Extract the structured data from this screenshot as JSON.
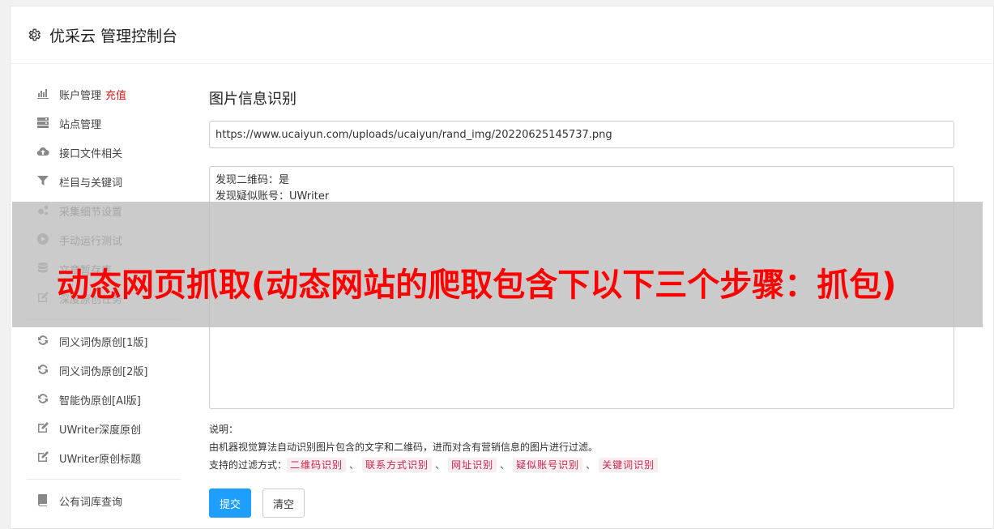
{
  "header": {
    "title": "优采云 管理控制台"
  },
  "sidebar": {
    "group1": [
      {
        "label": "账户管理",
        "extra": "充值",
        "icon": "bar-chart-icon"
      },
      {
        "label": "站点管理",
        "icon": "server-icon"
      },
      {
        "label": "接口文件相关",
        "icon": "cloud-upload-icon"
      },
      {
        "label": "栏目与关键词",
        "icon": "filter-icon"
      },
      {
        "label": "采集细节设置",
        "icon": "gears-icon"
      },
      {
        "label": "手动运行测试",
        "icon": "play-circle-icon"
      },
      {
        "label": "文章暂存库",
        "icon": "database-icon"
      },
      {
        "label": "深度原创任务",
        "icon": "edit-icon"
      }
    ],
    "group2": [
      {
        "label": "同义词伪原创[1版]",
        "icon": "refresh-icon"
      },
      {
        "label": "同义词伪原创[2版]",
        "icon": "refresh-icon"
      },
      {
        "label": "智能伪原创[AI版]",
        "icon": "refresh-icon"
      },
      {
        "label": "UWriter深度原创",
        "icon": "edit-icon"
      },
      {
        "label": "UWriter原创标题",
        "icon": "edit-icon"
      }
    ],
    "group3": [
      {
        "label": "公有词库查询",
        "icon": "book-icon"
      }
    ]
  },
  "main": {
    "title": "图片信息识别",
    "url_value": "https://www.ucaiyun.com/uploads/ucaiyun/rand_img/20220625145737.png",
    "result_text": "发现二维码：是\n发现疑似账号：UWriter",
    "notes": {
      "heading": "说明：",
      "desc": "由机器视觉算法自动识别图片包含的文字和二维码，进而对含有营销信息的图片进行过滤。",
      "methods_label": "支持的过滤方式：",
      "methods": [
        "二维码识别",
        "联系方式识别",
        "网址识别",
        "疑似账号识别",
        "关键词识别"
      ],
      "separator": "、"
    },
    "submit_label": "提交",
    "clear_label": "清空"
  },
  "overlay": {
    "text": "动态网页抓取(动态网站的爬取包含下以下三个步骤：抓包)"
  }
}
